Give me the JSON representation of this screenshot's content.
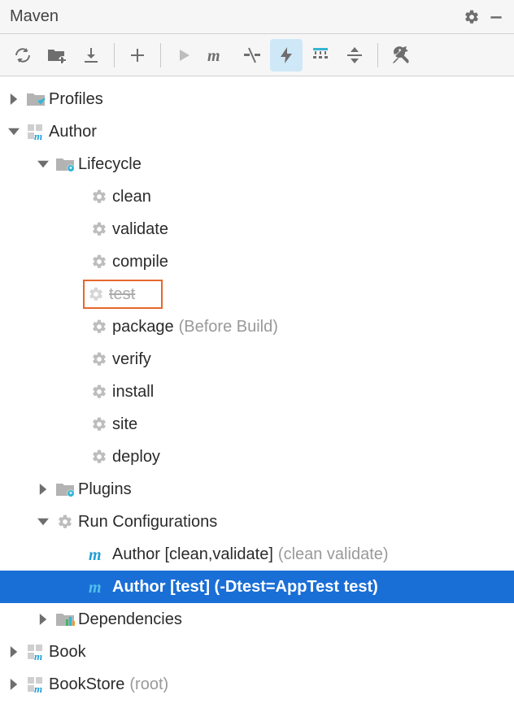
{
  "window": {
    "title": "Maven"
  },
  "tree": {
    "profiles": "Profiles",
    "author": "Author",
    "lifecycle": "Lifecycle",
    "phases": {
      "clean": "clean",
      "validate": "validate",
      "compile": "compile",
      "test": "test",
      "package": "package",
      "package_note": "(Before Build)",
      "verify": "verify",
      "install": "install",
      "site": "site",
      "deploy": "deploy"
    },
    "plugins": "Plugins",
    "runconfigs": "Run Configurations",
    "rc1": "Author [clean,validate]",
    "rc1_note": "(clean validate)",
    "rc2": "Author [test] (-Dtest=AppTest test)",
    "dependencies": "Dependencies",
    "book": "Book",
    "bookstore": "BookStore",
    "bookstore_note": "(root)"
  }
}
